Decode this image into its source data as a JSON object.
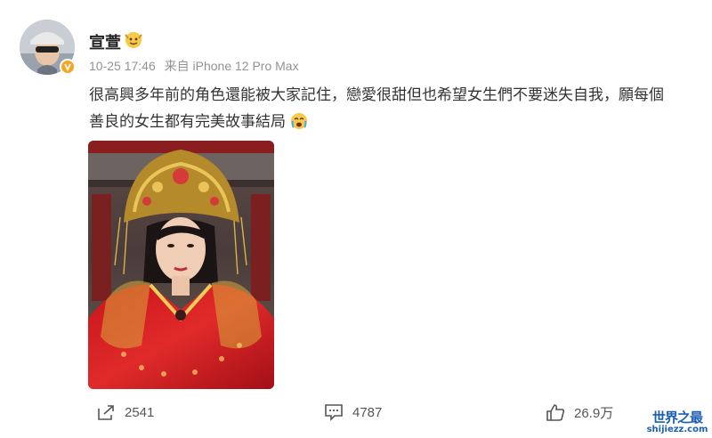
{
  "post": {
    "username": "宣萱",
    "timestamp": "10-25 17:46",
    "source": "来自 iPhone 12 Pro Max",
    "text_line_1": "很高興多年前的角色還能被大家記住，戀愛很甜但也希望女生們不要迷失自我，願每個",
    "text_line_2": "善良的女生都有完美故事結局",
    "verified_color": "#f5a623"
  },
  "actions": {
    "repost_count": "2541",
    "comment_count": "4787",
    "like_count": "26.9万",
    "repost_icon": "share-icon",
    "comment_icon": "comment-icon",
    "like_icon": "thumbs-up-icon"
  },
  "watermark": {
    "main": "世界之最",
    "sub": "shijiezz.com"
  }
}
